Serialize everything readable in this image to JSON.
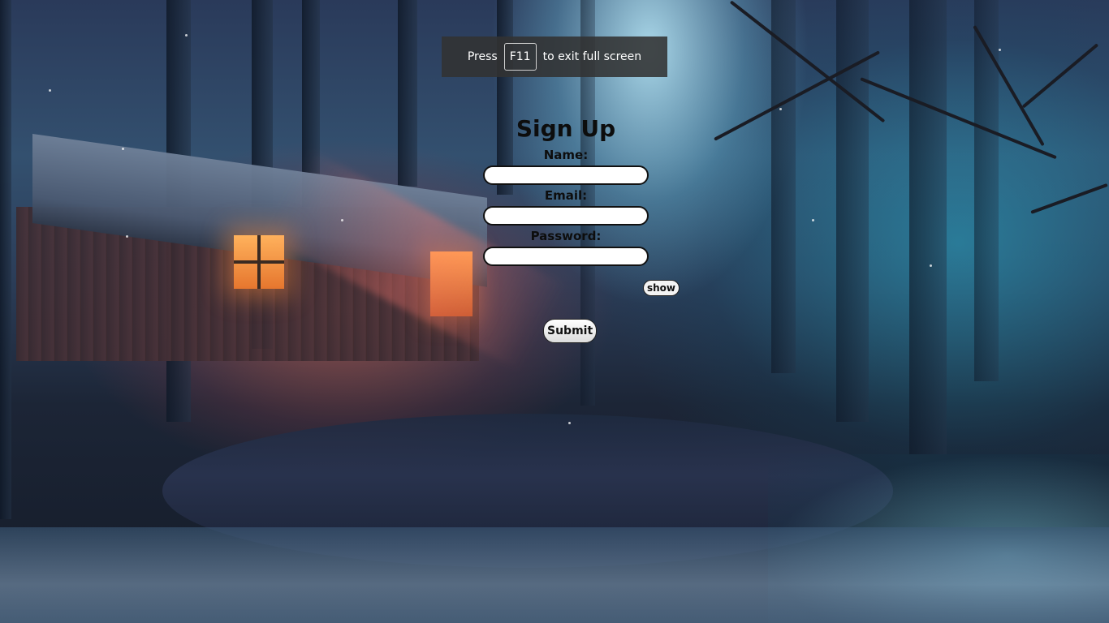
{
  "fullscreen_notice": {
    "prefix": "Press",
    "key": "F11",
    "suffix": "to exit full screen"
  },
  "form": {
    "title": "Sign Up",
    "name_label": "Name:",
    "name_value": "",
    "email_label": "Email:",
    "email_value": "",
    "password_label": "Password:",
    "password_value": "",
    "show_label": "show",
    "submit_label": "Submit"
  },
  "background": {
    "scene": "winter-forest-cabin"
  }
}
